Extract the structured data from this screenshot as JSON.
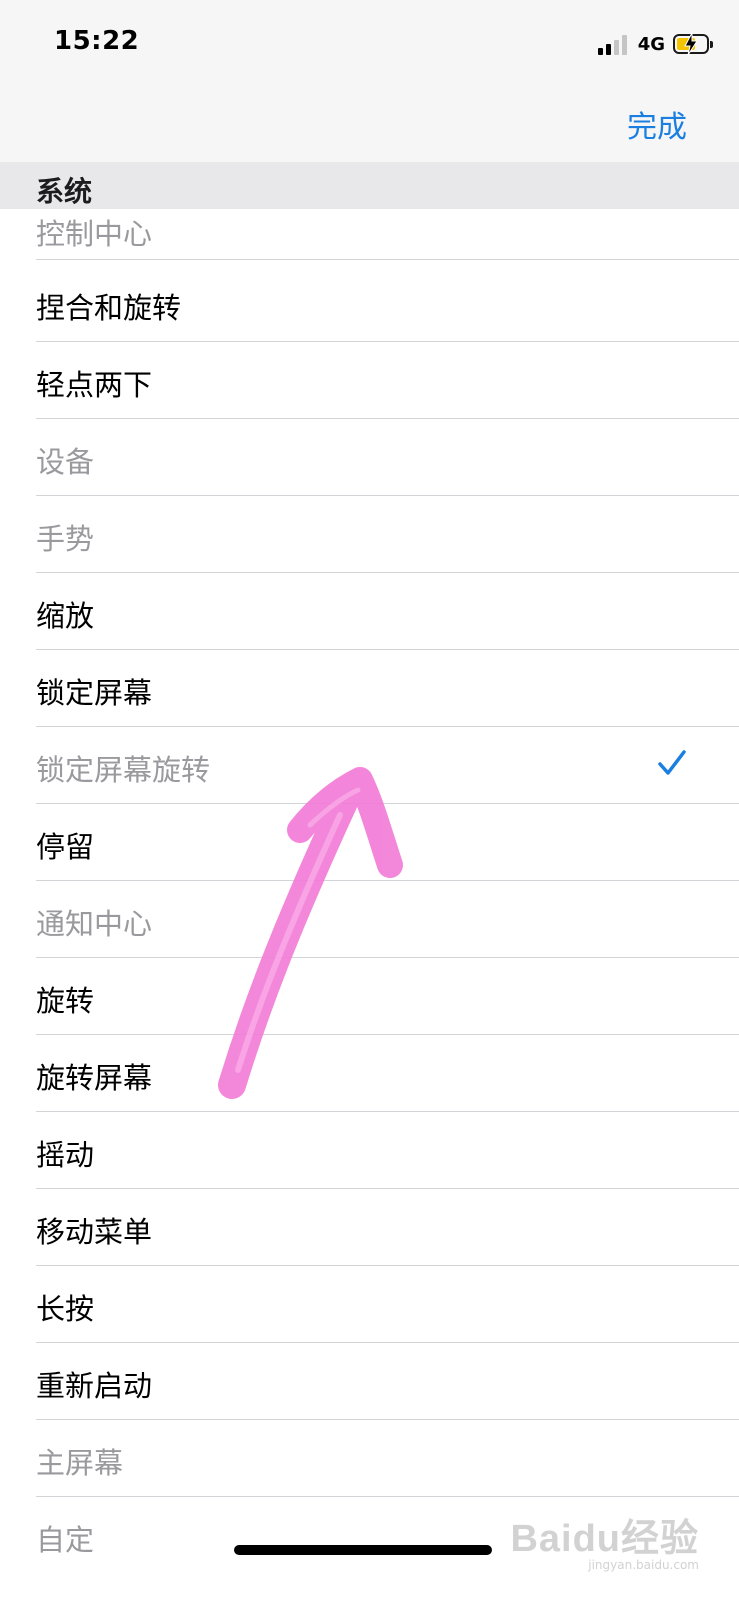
{
  "status_bar": {
    "time": "15:22",
    "network": "4G",
    "signal_icon": "signal-bars-icon",
    "battery_icon": "battery-charging-icon",
    "battery_color": "#f5c400"
  },
  "nav": {
    "done_label": "完成",
    "accent_color": "#1a7fe0"
  },
  "section": {
    "title": "系统"
  },
  "items": [
    {
      "label": "控制中心",
      "enabled": false,
      "checked": false
    },
    {
      "label": "捏合和旋转",
      "enabled": true,
      "checked": false
    },
    {
      "label": "轻点两下",
      "enabled": true,
      "checked": false
    },
    {
      "label": "设备",
      "enabled": false,
      "checked": false
    },
    {
      "label": "手势",
      "enabled": false,
      "checked": false
    },
    {
      "label": "缩放",
      "enabled": true,
      "checked": false
    },
    {
      "label": "锁定屏幕",
      "enabled": true,
      "checked": false
    },
    {
      "label": "锁定屏幕旋转",
      "enabled": false,
      "checked": true
    },
    {
      "label": "停留",
      "enabled": true,
      "checked": false
    },
    {
      "label": "通知中心",
      "enabled": false,
      "checked": false
    },
    {
      "label": "旋转",
      "enabled": true,
      "checked": false
    },
    {
      "label": "旋转屏幕",
      "enabled": true,
      "checked": false
    },
    {
      "label": "摇动",
      "enabled": true,
      "checked": false
    },
    {
      "label": "移动菜单",
      "enabled": true,
      "checked": false
    },
    {
      "label": "长按",
      "enabled": true,
      "checked": false
    },
    {
      "label": "重新启动",
      "enabled": true,
      "checked": false
    },
    {
      "label": "主屏幕",
      "enabled": false,
      "checked": false
    },
    {
      "label": "自定",
      "enabled": false,
      "checked": false
    }
  ],
  "annotation": {
    "icon": "pink-arrow-annotation-icon",
    "color": "#f27ad6"
  },
  "watermark": {
    "main": "Baidu经验",
    "sub": "jingyan.baidu.com"
  }
}
